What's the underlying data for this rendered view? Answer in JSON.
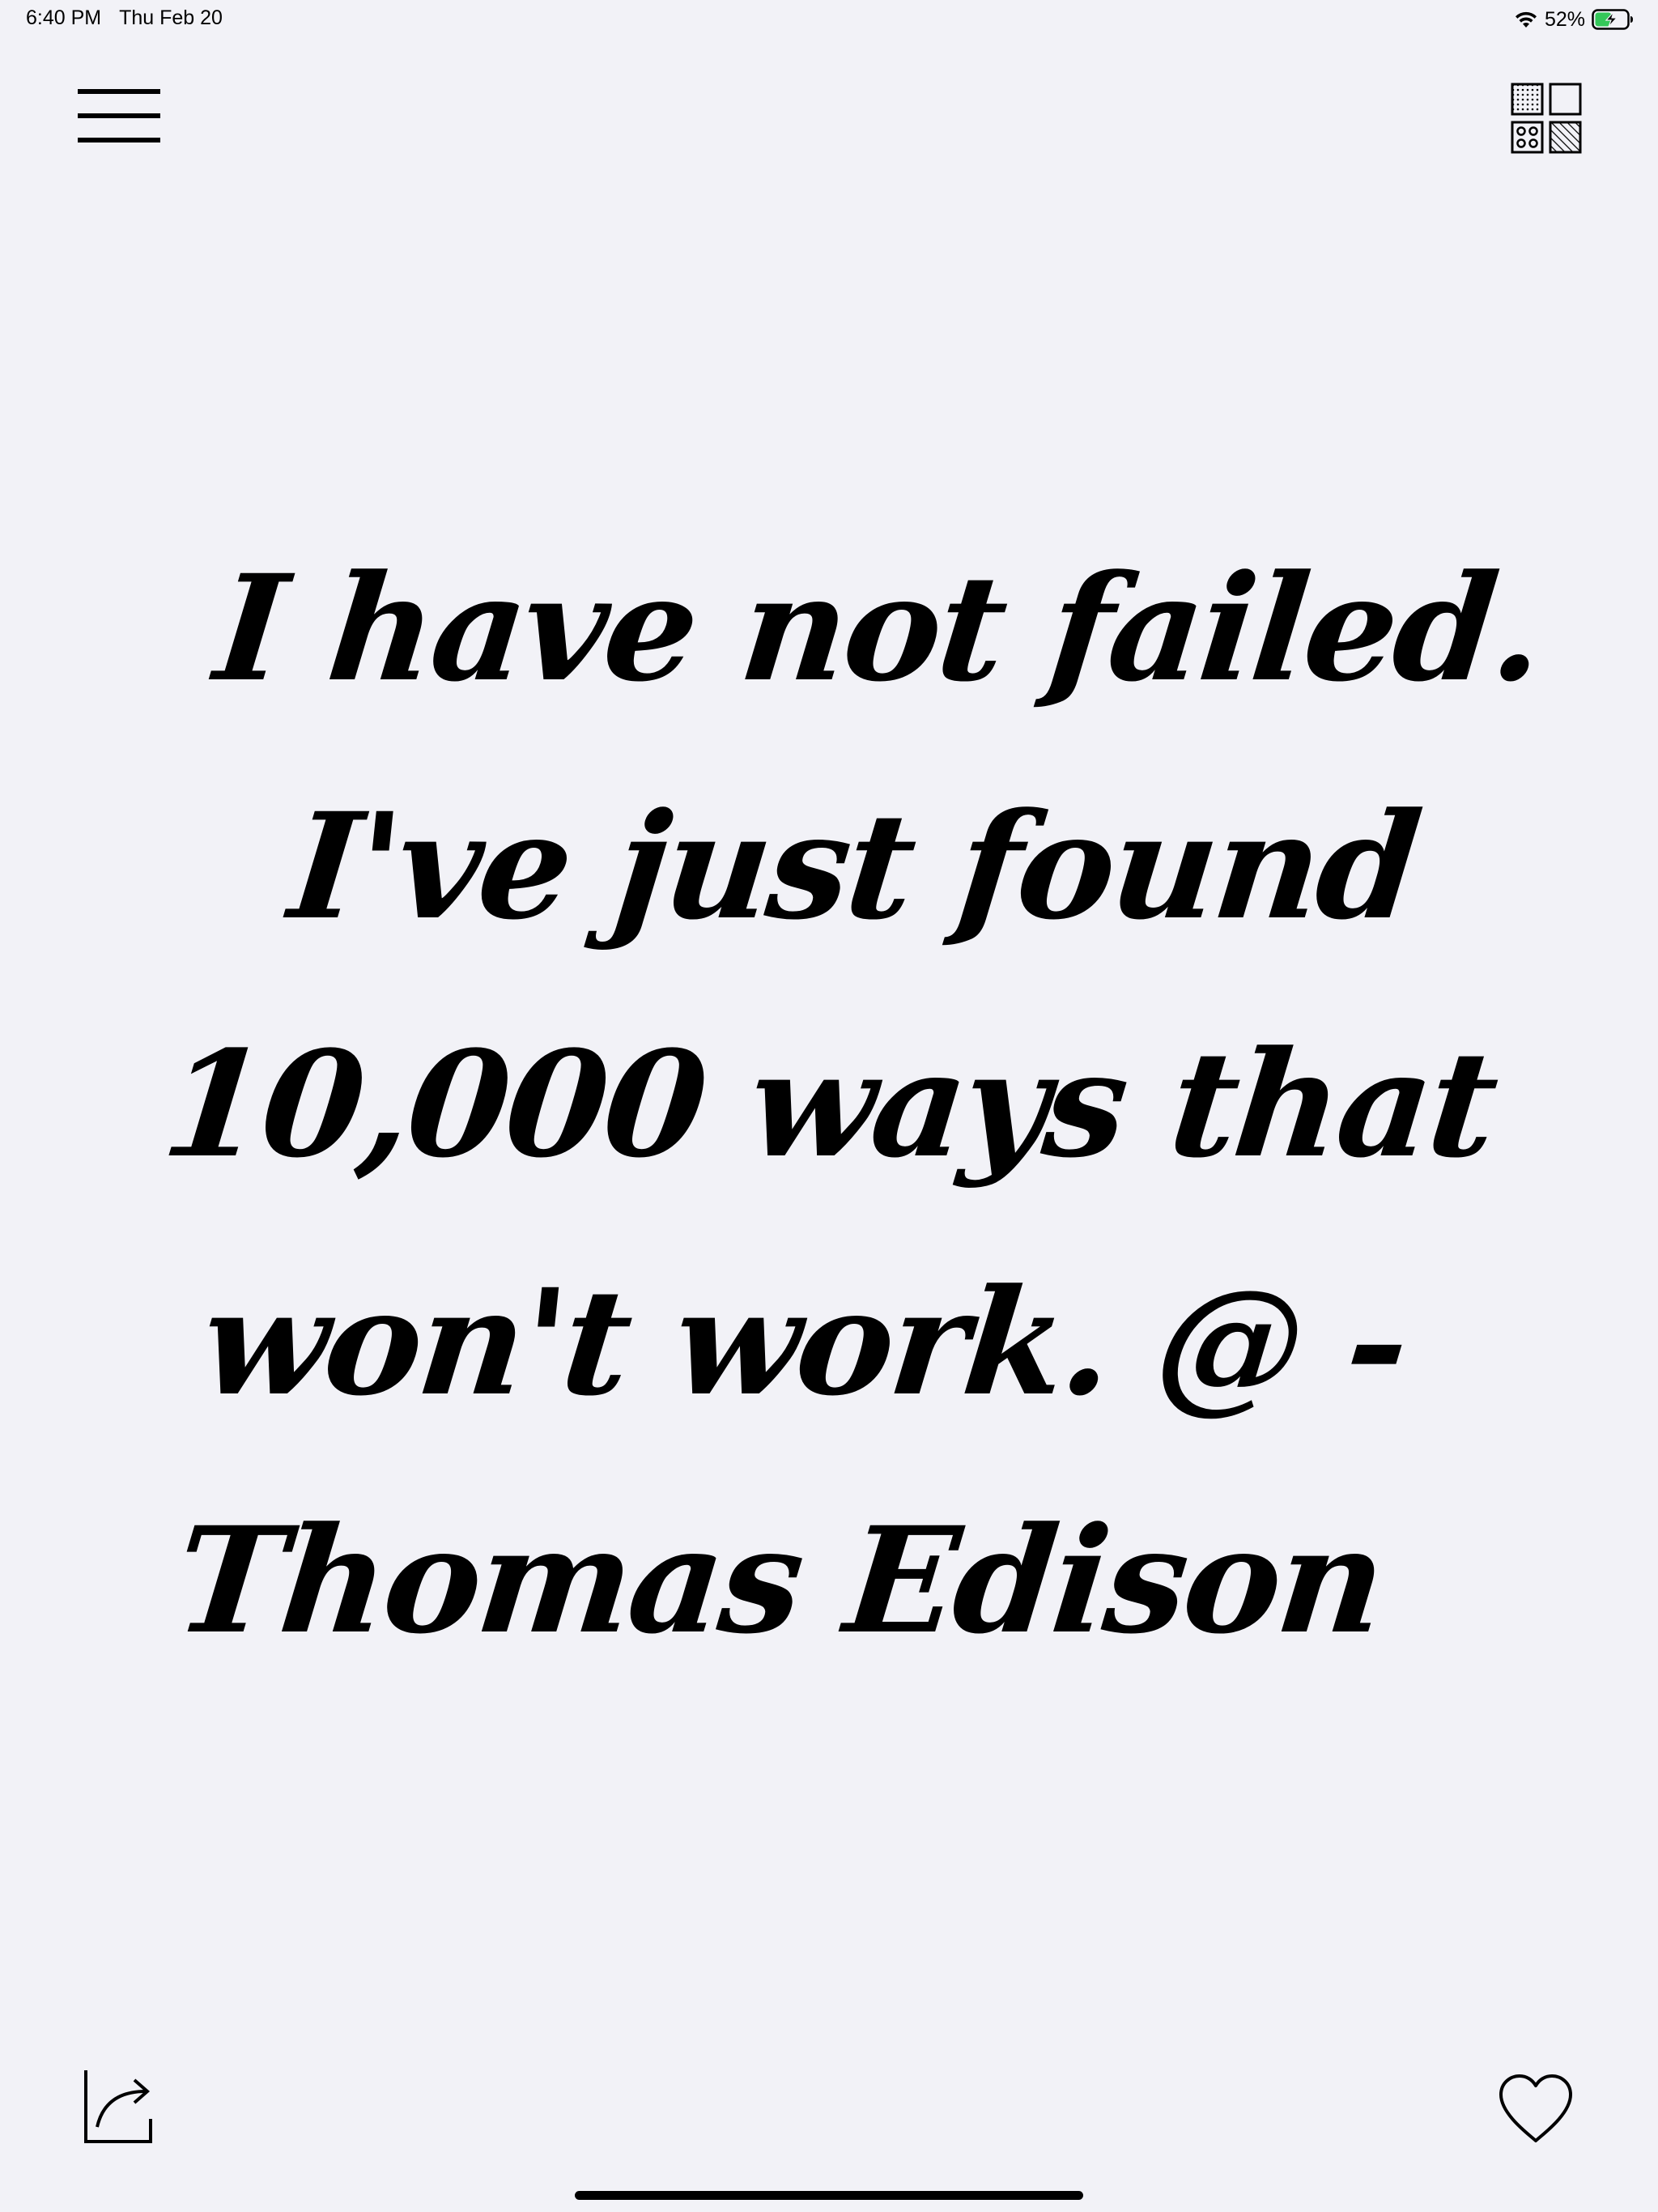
{
  "status_bar": {
    "time": "6:40 PM",
    "date": "Thu Feb 20",
    "battery_percent": "52%",
    "battery_level": 0.52,
    "battery_color": "#34c759"
  },
  "toolbar": {
    "menu_icon": "hamburger-menu-icon",
    "themes_icon": "pattern-grid-icon"
  },
  "quote": {
    "text": "I have not failed. I've just found 10,000 ways that won't work. @ -Thomas Edison"
  },
  "bottom_bar": {
    "share_icon": "share-icon",
    "favorite_icon": "heart-icon"
  },
  "colors": {
    "background": "#f2f2f7",
    "text": "#000000"
  }
}
